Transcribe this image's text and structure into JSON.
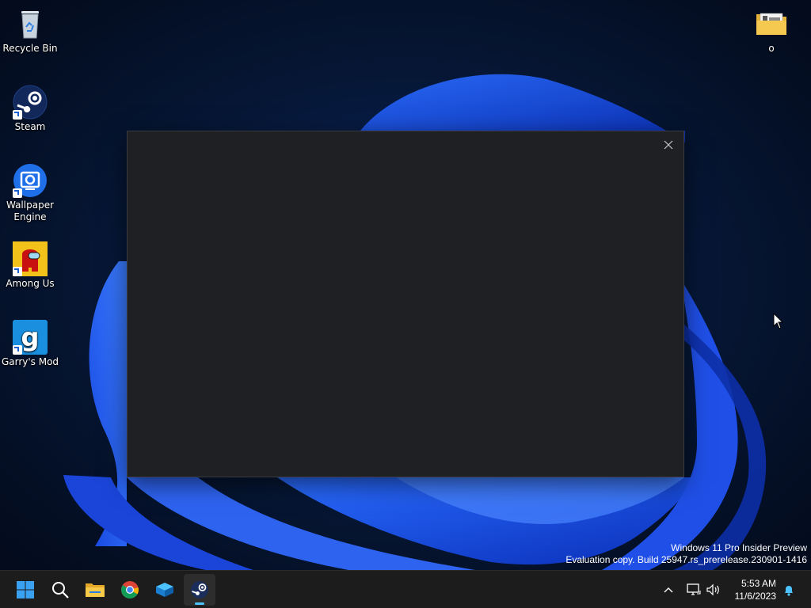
{
  "desktop": {
    "icons": [
      {
        "label": "Recycle Bin"
      },
      {
        "label": "Steam"
      },
      {
        "label": "Wallpaper Engine"
      },
      {
        "label": "Among Us"
      },
      {
        "label": "Garry's Mod"
      },
      {
        "label": "o"
      }
    ]
  },
  "watermark": {
    "line1": "Windows 11 Pro Insider Preview",
    "line2": "Evaluation copy. Build 25947.rs_prerelease.230901-1416"
  },
  "taskbar": {
    "clock_time": "5:53 AM",
    "clock_date": "11/6/2023",
    "pinned": [
      {
        "icon": "windows-start-icon"
      },
      {
        "icon": "search-icon"
      },
      {
        "icon": "file-explorer-icon"
      },
      {
        "icon": "chrome-icon"
      },
      {
        "icon": "virtualbox-icon"
      },
      {
        "icon": "steam-icon",
        "active": true
      }
    ]
  },
  "colors": {
    "accent": "#4cc2ff",
    "dialog_bg": "#1f2023",
    "taskbar_bg": "#1c1c1c"
  }
}
